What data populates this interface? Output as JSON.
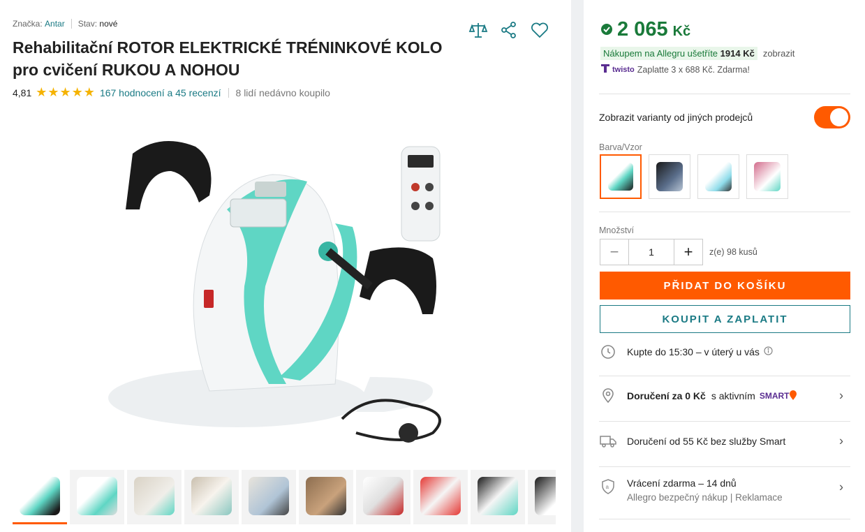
{
  "meta": {
    "brand_label": "Značka:",
    "brand_value": "Antar",
    "condition_label": "Stav:",
    "condition_value": "nové"
  },
  "title": "Rehabilitační ROTOR ELEKTRICKÉ TRÉNINKOVÉ KOLO pro cvičení RUKOU A NOHOU",
  "rating": {
    "score": "4,81",
    "stars": "★★★★★",
    "reviews_link": "167 hodnocení a 45 recenzí",
    "bought": "8 lidí nedávno koupilo"
  },
  "price": {
    "amount": "2 065",
    "currency": "Kč",
    "save_text": "Nákupem na Allegru ušetříte",
    "save_amount": "1914 Kč",
    "save_link": "zobrazit",
    "twisto_logo": "twisto",
    "twisto_text": "Zaplatte 3 x 688 Kč. Zdarma!"
  },
  "variants": {
    "toggle_label": "Zobrazit varianty od jiných prodejců",
    "color_label": "Barva/Vzor"
  },
  "quantity": {
    "label": "Množství",
    "value": "1",
    "minus": "−",
    "plus": "+",
    "available": "z(e) 98 kusů"
  },
  "buttons": {
    "add_to_cart": "PŘIDAT DO KOŠÍKU",
    "buy_now": "KOUPIT A ZAPLATIT"
  },
  "delivery": {
    "order_by": "Kupte do 15:30 – v úterý u vás",
    "free_delivery_bold": "Doručení za 0 Kč",
    "free_delivery_rest": "s aktivním",
    "smart_logo": "SMART",
    "delivery_from": "Doručení od 55 Kč bez služby Smart",
    "returns": "Vrácení zdarma – 14 dnů",
    "returns_sub": "Allegro bezpečný nákup | Reklamace"
  },
  "colors": {
    "accent": "#ff5a00",
    "teal": "#1a7a84",
    "price_green": "#1a7a3a"
  }
}
